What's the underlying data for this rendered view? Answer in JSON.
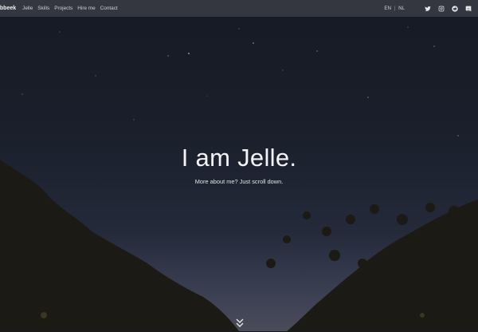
{
  "brand": {
    "name": "ebbeek"
  },
  "nav": {
    "items": [
      "Jelle",
      "Skills",
      "Projects",
      "Hire me",
      "Contact"
    ]
  },
  "language": {
    "en": "EN",
    "separator": "|",
    "nl": "NL"
  },
  "social": [
    "twitter-icon",
    "instagram-icon",
    "reddit-icon",
    "discord-icon"
  ],
  "hero": {
    "title": "I am Jelle.",
    "subtitle": "More about me? Just scroll down."
  },
  "colors": {
    "navbar": "#34373f",
    "sky_top": "#161a24",
    "sky_bottom": "#4b4c5a",
    "text": "#f4f4f6"
  }
}
